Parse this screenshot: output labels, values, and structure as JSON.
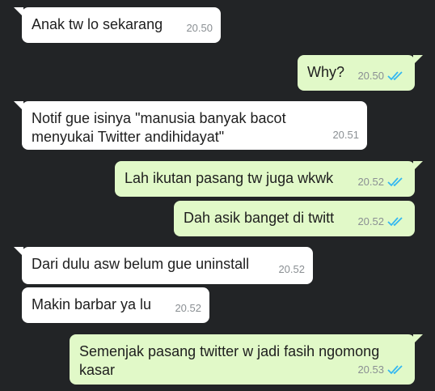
{
  "chat": {
    "messages": [
      {
        "direction": "in",
        "text": "Anak tw lo sekarang",
        "time": "20.50"
      },
      {
        "direction": "out",
        "text": "Why?",
        "time": "20.50",
        "status": "read-double-check-icon"
      },
      {
        "direction": "in",
        "text": "Notif gue isinya \"manusia banyak bacot menyukai Twitter andihidayat\"",
        "time": "20.51"
      },
      {
        "direction": "out",
        "text": "Lah ikutan pasang tw juga wkwk",
        "time": "20.52",
        "status": "read-double-check-icon"
      },
      {
        "direction": "out",
        "text": "Dah asik banget di twitt",
        "time": "20.52",
        "status": "read-double-check-icon"
      },
      {
        "direction": "in",
        "text": "Dari dulu asw belum gue uninstall",
        "time": "20.52"
      },
      {
        "direction": "in",
        "text": "Makin barbar ya lu",
        "time": "20.52"
      },
      {
        "direction": "out",
        "text": "Semenjak pasang twitter w jadi fasih ngomong kasar",
        "time": "20.53",
        "status": "read-double-check-icon"
      }
    ]
  },
  "colors": {
    "background": "#222426",
    "incoming_bubble": "#ffffff",
    "outgoing_bubble": "#e1f9c8",
    "read_ticks": "#34b7f1",
    "timestamp": "#8a8f93"
  }
}
